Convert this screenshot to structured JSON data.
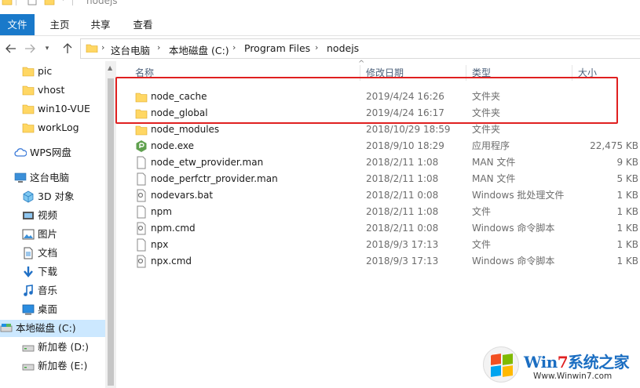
{
  "window": {
    "title": "nodejs"
  },
  "ribbon": {
    "tabs": [
      {
        "label": "文件",
        "active": true
      },
      {
        "label": "主页"
      },
      {
        "label": "共享"
      },
      {
        "label": "查看"
      }
    ]
  },
  "address": {
    "breadcrumbs": [
      "这台电脑",
      "本地磁盘 (C:)",
      "Program Files",
      "nodejs"
    ],
    "separator": "›"
  },
  "nav": {
    "items": [
      {
        "label": "pic",
        "icon": "folder-icon"
      },
      {
        "label": "vhost",
        "icon": "folder-icon"
      },
      {
        "label": "win10-VUE",
        "icon": "folder-icon"
      },
      {
        "label": "workLog",
        "icon": "folder-icon"
      },
      {
        "label": "WPS网盘",
        "icon": "cloud-icon"
      },
      {
        "label": "这台电脑",
        "icon": "computer-icon"
      },
      {
        "label": "3D 对象",
        "icon": "3d-objects-icon"
      },
      {
        "label": "视频",
        "icon": "video-icon"
      },
      {
        "label": "图片",
        "icon": "pictures-icon"
      },
      {
        "label": "文档",
        "icon": "documents-icon"
      },
      {
        "label": "下载",
        "icon": "download-icon"
      },
      {
        "label": "音乐",
        "icon": "music-icon"
      },
      {
        "label": "桌面",
        "icon": "desktop-icon"
      },
      {
        "label": "本地磁盘 (C:)",
        "icon": "drive-icon",
        "selected": true
      },
      {
        "label": "新加卷 (D:)",
        "icon": "drive-icon"
      },
      {
        "label": "新加卷 (E:)",
        "icon": "drive-icon"
      }
    ]
  },
  "columns": {
    "name": "名称",
    "date": "修改日期",
    "type": "类型",
    "size": "大小"
  },
  "files": [
    {
      "name": "node_cache",
      "date": "2019/4/24 16:26",
      "type": "文件夹",
      "size": "",
      "icon": "folder"
    },
    {
      "name": "node_global",
      "date": "2019/4/24 16:17",
      "type": "文件夹",
      "size": "",
      "icon": "folder"
    },
    {
      "name": "node_modules",
      "date": "2018/10/29 18:59",
      "type": "文件夹",
      "size": "",
      "icon": "folder"
    },
    {
      "name": "node.exe",
      "date": "2018/9/10 18:29",
      "type": "应用程序",
      "size": "22,475 KB",
      "icon": "node"
    },
    {
      "name": "node_etw_provider.man",
      "date": "2018/2/11 1:08",
      "type": "MAN 文件",
      "size": "9 KB",
      "icon": "file"
    },
    {
      "name": "node_perfctr_provider.man",
      "date": "2018/2/11 1:08",
      "type": "MAN 文件",
      "size": "5 KB",
      "icon": "file"
    },
    {
      "name": "nodevars.bat",
      "date": "2018/2/11 0:08",
      "type": "Windows 批处理文件",
      "size": "1 KB",
      "icon": "script"
    },
    {
      "name": "npm",
      "date": "2018/2/11 1:08",
      "type": "文件",
      "size": "1 KB",
      "icon": "file"
    },
    {
      "name": "npm.cmd",
      "date": "2018/2/11 0:08",
      "type": "Windows 命令脚本",
      "size": "1 KB",
      "icon": "script"
    },
    {
      "name": "npx",
      "date": "2018/9/3 17:13",
      "type": "文件",
      "size": "1 KB",
      "icon": "file"
    },
    {
      "name": "npx.cmd",
      "date": "2018/9/3 17:13",
      "type": "Windows 命令脚本",
      "size": "1 KB",
      "icon": "script"
    }
  ],
  "watermark": {
    "brand_prefix": "Win",
    "brand_seven": "7",
    "brand_suffix": "系统之家",
    "url": "Www.Winwin7.com"
  },
  "colors": {
    "accent": "#1979ca",
    "selection": "#cce8ff",
    "folder": "#ffd764",
    "highlight": "#e02020"
  }
}
